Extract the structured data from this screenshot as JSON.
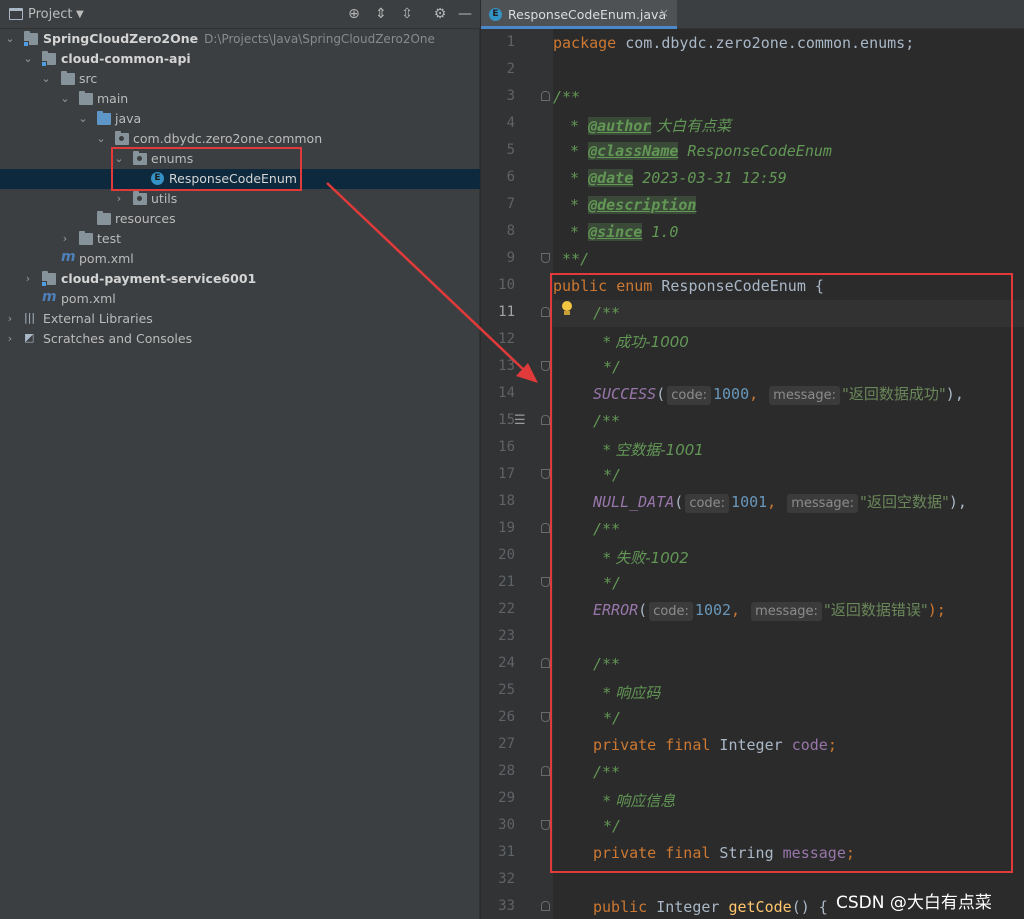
{
  "project_pane": {
    "title": "Project",
    "tree": [
      {
        "label": "SpringCloudZero2One",
        "hint": "D:\\Projects\\Java\\SpringCloudZero2One",
        "icon": "module-folder-icon",
        "expanded": true
      },
      {
        "label": "cloud-common-api",
        "icon": "module-folder-icon",
        "expanded": true
      },
      {
        "label": "src",
        "icon": "folder-icon",
        "expanded": true
      },
      {
        "label": "main",
        "icon": "folder-icon",
        "expanded": true
      },
      {
        "label": "java",
        "icon": "source-folder-icon",
        "expanded": true
      },
      {
        "label": "com.dbydc.zero2one.common",
        "icon": "package-icon",
        "expanded": true
      },
      {
        "label": "enums",
        "icon": "package-icon",
        "expanded": true
      },
      {
        "label": "ResponseCodeEnum",
        "icon": "enum-class-icon",
        "selected": true
      },
      {
        "label": "utils",
        "icon": "package-icon",
        "expanded": false
      },
      {
        "label": "resources",
        "icon": "resources-folder-icon"
      },
      {
        "label": "test",
        "icon": "folder-icon",
        "expanded": false
      },
      {
        "label": "pom.xml",
        "icon": "maven-icon"
      },
      {
        "label": "cloud-payment-service6001",
        "icon": "module-folder-icon",
        "expanded": false
      },
      {
        "label": "pom.xml",
        "icon": "maven-icon"
      },
      {
        "label": "External Libraries",
        "icon": "libraries-icon",
        "expanded": false
      },
      {
        "label": "Scratches and Consoles",
        "icon": "scratches-icon",
        "expanded": false
      }
    ]
  },
  "editor": {
    "tab_label": "ResponseCodeEnum.java",
    "line_numbers": [
      "1",
      "2",
      "3",
      "4",
      "5",
      "6",
      "7",
      "8",
      "9",
      "10",
      "11",
      "12",
      "13",
      "14",
      "15",
      "16",
      "17",
      "18",
      "19",
      "20",
      "21",
      "22",
      "23",
      "24",
      "25",
      "26",
      "27",
      "28",
      "29",
      "30",
      "31",
      "32",
      "33"
    ],
    "current_line": 11,
    "code": {
      "l1_kw": "package",
      "l1_rest": " com.dbydc.zero2one.common.enums;",
      "doc_open": "/**",
      "l4_tag": "@author",
      "l4_val": " 大白有点菜",
      "l5_tag": "@className",
      "l5_val": " ResponseCodeEnum",
      "l6_tag": "@date",
      "l6_val": " 2023-03-31 12:59",
      "l7_tag": "@description",
      "l8_tag": "@since",
      "l8_val": " 1.0",
      "l9": " **/",
      "l10_kw": "public enum",
      "l10_name": " ResponseCodeEnum {",
      "l12": "* 成功-1000",
      "doc_close": "*/",
      "l14_const": "SUCCESS",
      "l14_code": "1000",
      "l14_msg": "\"返回数据成功\"",
      "l16": "* 空数据-1001",
      "l18_const": "NULL_DATA",
      "l18_code": "1001",
      "l18_msg": "\"返回空数据\"",
      "l20": "* 失败-1002",
      "l22_const": "ERROR",
      "l22_code": "1002",
      "l22_msg": "\"返回数据错误\"",
      "l25": "* 响应码",
      "l27_kw": "private final",
      "l27_type": " Integer ",
      "l27_field": "code",
      "l29": "* 响应信息",
      "l31_type": " String ",
      "l31_field": "message",
      "l33_kw": "public",
      "l33_type": " Integer ",
      "l33_meth": "getCode",
      "l33_rest": "() {",
      "hint_code": "code:",
      "hint_message": "message:",
      "comma": ",",
      "close": "),",
      "close_last": ");",
      "semi": ";",
      "open_paren": "("
    }
  },
  "watermark": "CSDN @大白有点菜",
  "colors": {
    "annotation": "#e03a3a",
    "selection": "#0d293e",
    "accent": "#4a88c7"
  }
}
